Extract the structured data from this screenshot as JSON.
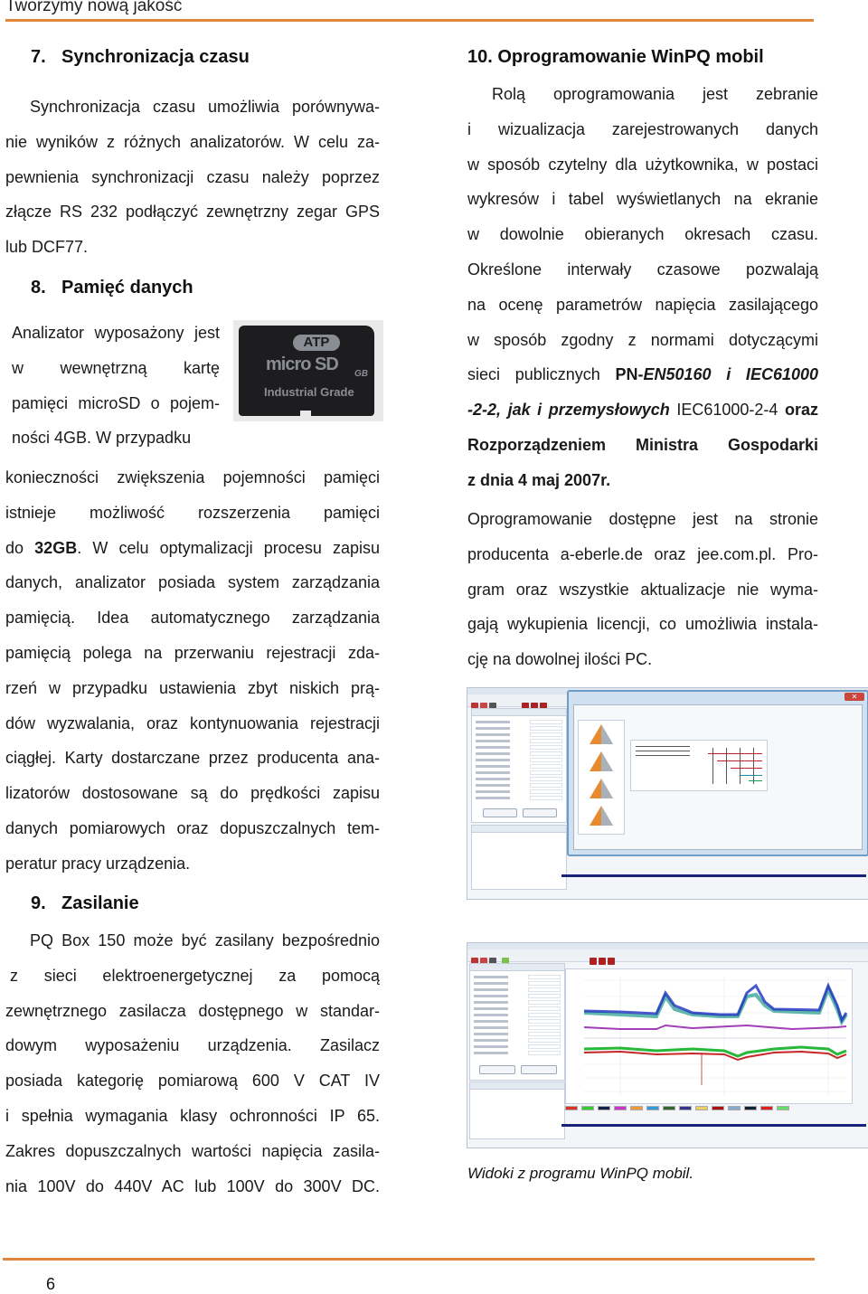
{
  "header": {
    "title": "Tworzymy nową jakość"
  },
  "left_column": {
    "section7": {
      "number": "7.",
      "title": "Synchronizacja czasu",
      "lines": [
        "Synchronizacja czasu umożliwia porównywa-",
        "nie wyników z różnych analizatorów. W celu za-",
        "pewnienia synchronizacji czasu należy poprzez",
        "złącze RS 232 podłączyć zewnętrzny zegar GPS",
        "lub DCF77."
      ]
    },
    "section8": {
      "number": "8.",
      "title": "Pamięć danych",
      "wrap_lines": [
        "Analizator wyposażony jest",
        "w wewnętrzną kartę",
        "pamięci microSD o pojem-",
        "ności 4GB. W przypadku"
      ],
      "lines": [
        "konieczności zwiększenia pojemności pamięci",
        "istnieje możliwość rozszerzenia pamięci",
        {
          "pre": "do ",
          "bold": "32GB",
          "post": ". W celu optymalizacji procesu zapisu"
        },
        "danych, analizator posiada system zarządzania",
        "pamięcią. Idea automatycznego zarządzania",
        "pamięcią polega na przerwaniu rejestracji zda-",
        "rzeń w przypadku ustawienia zbyt niskich prą-",
        "dów wyzwalania, oraz kontynuowania rejestracji",
        "ciągłej. Karty dostarczane przez producenta ana-",
        "lizatorów dostosowane są do prędkości zapisu",
        "danych pomiarowych oraz dopuszczalnych tem-",
        "peratur pracy urządzenia."
      ],
      "sd_card_image": {
        "brand": "ATP",
        "logo": "micro SD",
        "capacity_label": "GB",
        "grade": "Industrial Grade"
      }
    },
    "section9": {
      "number": "9.",
      "title": "Zasilanie",
      "lines": [
        "PQ Box 150 może być zasilany bezpośrednio",
        "z sieci elektroenergetycznej za pomocą",
        "zewnętrznego zasilacza dostępnego w standar-",
        "dowym wyposażeniu urządzenia. Zasilacz",
        "posiada kategorię pomiarową 600 V CAT IV",
        "i spełnia wymagania klasy ochronności IP 65.",
        "Zakres dopuszczalnych wartości napięcia zasila-",
        "nia 100V do 440V AC lub 100V do 300V DC."
      ]
    }
  },
  "right_column": {
    "section10": {
      "number": "10.",
      "title": "Oprogramowanie WinPQ mobil",
      "lines_p1": [
        "Rolą oprogramowania jest zebranie",
        "i wizualizacja zarejestrowanych danych",
        "w sposób czytelny dla użytkownika, w postaci",
        "wykresów i tabel wyświetlanych na ekranie",
        "w dowolnie obieranych okresach czasu.",
        "Określone interwały czasowe pozwalają",
        "na ocenę parametrów napięcia zasilającego",
        "w sposób zgodny z normami dotyczącymi"
      ],
      "line_standards": {
        "pre": "sieci publicznych ",
        "bold": "PN-",
        "bold_italic": "EN50160 i IEC61000"
      },
      "line_standards2": {
        "bold_italic": "-2-2, jak i przemysłowych",
        "plain": " IEC61000-2-4 ",
        "bold": "oraz"
      },
      "bold_lines": [
        "Rozporządzeniem Ministra Gospodarki",
        "z dnia 4 maj 2007r."
      ],
      "lines_p2": [
        "Oprogramowanie dostępne jest na stronie",
        "producenta a-eberle.de oraz jee.com.pl. Pro-",
        "gram oraz wszystkie aktualizacje nie wyma-",
        "gają wykupienia licencji, co umożliwia instala-",
        "cję na dowolnej ilości PC."
      ],
      "screenshot1": {
        "description": "WinPQ mobil — analyzer settings dialog"
      },
      "screenshot2": {
        "description": "WinPQ mobil — measurement chart view"
      },
      "caption": "Widoki z programu WinPQ mobil."
    }
  },
  "footer": {
    "page_number": "6"
  },
  "colors": {
    "accent_rule": "#e0853a"
  }
}
